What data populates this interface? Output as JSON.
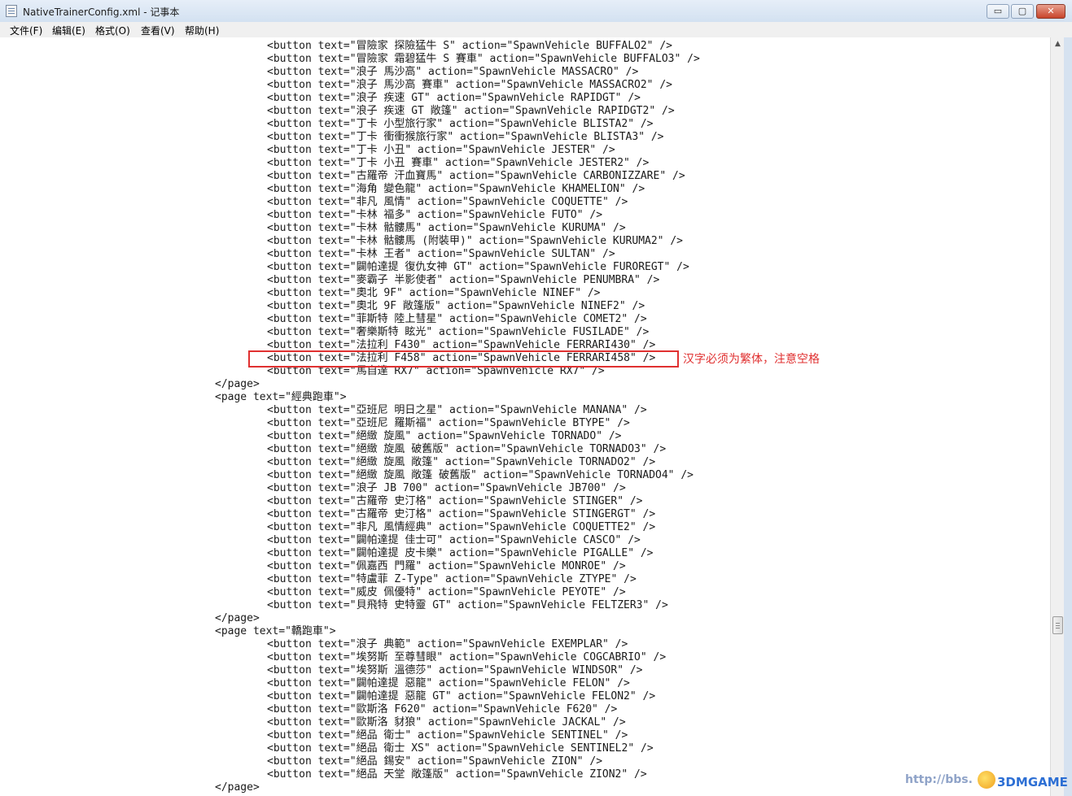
{
  "window": {
    "title": "NativeTrainerConfig.xml - 记事本",
    "buttons": {
      "minimize": "▭",
      "maximize": "▢",
      "close": "✕"
    }
  },
  "menu": [
    "文件(F)",
    "编辑(E)",
    "格式(O)",
    "查看(V)",
    "帮助(H)"
  ],
  "lines": [
    {
      "indent": 2,
      "text": "<button text=\"冒險家 探險猛牛 S\" action=\"SpawnVehicle BUFFALO2\" />"
    },
    {
      "indent": 2,
      "text": "<button text=\"冒險家 霜碧猛牛 S 賽車\" action=\"SpawnVehicle BUFFALO3\" />"
    },
    {
      "indent": 2,
      "text": "<button text=\"浪子 馬沙高\" action=\"SpawnVehicle MASSACRO\" />"
    },
    {
      "indent": 2,
      "text": "<button text=\"浪子 馬沙高 賽車\" action=\"SpawnVehicle MASSACRO2\" />"
    },
    {
      "indent": 2,
      "text": "<button text=\"浪子 疾速 GT\" action=\"SpawnVehicle RAPIDGT\" />"
    },
    {
      "indent": 2,
      "text": "<button text=\"浪子 疾速 GT 敞篷\" action=\"SpawnVehicle RAPIDGT2\" />"
    },
    {
      "indent": 2,
      "text": "<button text=\"丁卡 小型旅行家\" action=\"SpawnVehicle BLISTA2\" />"
    },
    {
      "indent": 2,
      "text": "<button text=\"丁卡 衝衝猴旅行家\" action=\"SpawnVehicle BLISTA3\" />"
    },
    {
      "indent": 2,
      "text": "<button text=\"丁卡 小丑\" action=\"SpawnVehicle JESTER\" />"
    },
    {
      "indent": 2,
      "text": "<button text=\"丁卡 小丑 賽車\" action=\"SpawnVehicle JESTER2\" />"
    },
    {
      "indent": 2,
      "text": "<button text=\"古羅帝 汗血寶馬\" action=\"SpawnVehicle CARBONIZZARE\" />"
    },
    {
      "indent": 2,
      "text": "<button text=\"海角 變色龍\" action=\"SpawnVehicle KHAMELION\" />"
    },
    {
      "indent": 2,
      "text": "<button text=\"非凡 風情\" action=\"SpawnVehicle COQUETTE\" />"
    },
    {
      "indent": 2,
      "text": "<button text=\"卡林 福多\" action=\"SpawnVehicle FUTO\" />"
    },
    {
      "indent": 2,
      "text": "<button text=\"卡林 骷髏馬\" action=\"SpawnVehicle KURUMA\" />"
    },
    {
      "indent": 2,
      "text": "<button text=\"卡林 骷髏馬 (附裝甲)\" action=\"SpawnVehicle KURUMA2\" />"
    },
    {
      "indent": 2,
      "text": "<button text=\"卡林 王者\" action=\"SpawnVehicle SULTAN\" />"
    },
    {
      "indent": 2,
      "text": "<button text=\"闢帕達提 復仇女神 GT\" action=\"SpawnVehicle FUROREGT\" />"
    },
    {
      "indent": 2,
      "text": "<button text=\"麥霸子 半影使者\" action=\"SpawnVehicle PENUMBRA\" />"
    },
    {
      "indent": 2,
      "text": "<button text=\"奧北 9F\" action=\"SpawnVehicle NINEF\" />"
    },
    {
      "indent": 2,
      "text": "<button text=\"奧北 9F 敞篷版\" action=\"SpawnVehicle NINEF2\" />"
    },
    {
      "indent": 2,
      "text": "<button text=\"菲斯特 陸上彗星\" action=\"SpawnVehicle COMET2\" />"
    },
    {
      "indent": 2,
      "text": "<button text=\"奢樂斯特 眩光\" action=\"SpawnVehicle FUSILADE\" />"
    },
    {
      "indent": 2,
      "text": "<button text=\"法拉利 F430\" action=\"SpawnVehicle FERRARI430\" />"
    },
    {
      "indent": 2,
      "text": "<button text=\"法拉利 F458\" action=\"SpawnVehicle FERRARI458\" />"
    },
    {
      "indent": 2,
      "text": "<button text=\"馬自達 RX7\" action=\"SpawnVehicle RX7\" />"
    },
    {
      "indent": 1,
      "text": "</page>"
    },
    {
      "indent": 1,
      "text": "<page text=\"經典跑車\">"
    },
    {
      "indent": 2,
      "text": "<button text=\"亞班尼 明日之星\" action=\"SpawnVehicle MANANA\" />"
    },
    {
      "indent": 2,
      "text": "<button text=\"亞班尼 羅斯福\" action=\"SpawnVehicle BTYPE\" />"
    },
    {
      "indent": 2,
      "text": "<button text=\"絕緻 旋風\" action=\"SpawnVehicle TORNADO\" />"
    },
    {
      "indent": 2,
      "text": "<button text=\"絕緻 旋風 破舊版\" action=\"SpawnVehicle TORNADO3\" />"
    },
    {
      "indent": 2,
      "text": "<button text=\"絕緻 旋風 敞篷\" action=\"SpawnVehicle TORNADO2\" />"
    },
    {
      "indent": 2,
      "text": "<button text=\"絕緻 旋風 敞篷 破舊版\" action=\"SpawnVehicle TORNADO4\" />"
    },
    {
      "indent": 2,
      "text": "<button text=\"浪子 JB 700\" action=\"SpawnVehicle JB700\" />"
    },
    {
      "indent": 2,
      "text": "<button text=\"古羅帝 史汀格\" action=\"SpawnVehicle STINGER\" />"
    },
    {
      "indent": 2,
      "text": "<button text=\"古羅帝 史汀格\" action=\"SpawnVehicle STINGERGT\" />"
    },
    {
      "indent": 2,
      "text": "<button text=\"非凡 風情經典\" action=\"SpawnVehicle COQUETTE2\" />"
    },
    {
      "indent": 2,
      "text": "<button text=\"闢帕達提 佳士可\" action=\"SpawnVehicle CASCO\" />"
    },
    {
      "indent": 2,
      "text": "<button text=\"闢帕達提 皮卡樂\" action=\"SpawnVehicle PIGALLE\" />"
    },
    {
      "indent": 2,
      "text": "<button text=\"佩嘉西 門羅\" action=\"SpawnVehicle MONROE\" />"
    },
    {
      "indent": 2,
      "text": "<button text=\"特盧菲 Z-Type\" action=\"SpawnVehicle ZTYPE\" />"
    },
    {
      "indent": 2,
      "text": "<button text=\"威皮 佩優特\" action=\"SpawnVehicle PEYOTE\" />"
    },
    {
      "indent": 2,
      "text": "<button text=\"貝飛特 史特靈 GT\" action=\"SpawnVehicle FELTZER3\" />"
    },
    {
      "indent": 1,
      "text": "</page>"
    },
    {
      "indent": 1,
      "text": "<page text=\"轎跑車\">"
    },
    {
      "indent": 2,
      "text": "<button text=\"浪子 典範\" action=\"SpawnVehicle EXEMPLAR\" />"
    },
    {
      "indent": 2,
      "text": "<button text=\"埃努斯 至尊彗眼\" action=\"SpawnVehicle COGCABRIO\" />"
    },
    {
      "indent": 2,
      "text": "<button text=\"埃努斯 溫德莎\" action=\"SpawnVehicle WINDSOR\" />"
    },
    {
      "indent": 2,
      "text": "<button text=\"闢帕達提 惡龍\" action=\"SpawnVehicle FELON\" />"
    },
    {
      "indent": 2,
      "text": "<button text=\"闢帕達提 惡龍 GT\" action=\"SpawnVehicle FELON2\" />"
    },
    {
      "indent": 2,
      "text": "<button text=\"歐斯洛 F620\" action=\"SpawnVehicle F620\" />"
    },
    {
      "indent": 2,
      "text": "<button text=\"歐斯洛 豺狼\" action=\"SpawnVehicle JACKAL\" />"
    },
    {
      "indent": 2,
      "text": "<button text=\"絕品 衛士\" action=\"SpawnVehicle SENTINEL\" />"
    },
    {
      "indent": 2,
      "text": "<button text=\"絕品 衛士 XS\" action=\"SpawnVehicle SENTINEL2\" />"
    },
    {
      "indent": 2,
      "text": "<button text=\"絕品 錫安\" action=\"SpawnVehicle ZION\" />"
    },
    {
      "indent": 2,
      "text": "<button text=\"絕品 天堂 敞篷版\" action=\"SpawnVehicle ZION2\" />"
    },
    {
      "indent": 1,
      "text": "</page>"
    }
  ],
  "annotation": {
    "highlight_line": 24,
    "text": "汉字必须为繁体，注意空格",
    "color": "#e03030"
  },
  "watermark": {
    "url": "http://bbs.",
    "brand": "3DMGAME"
  }
}
